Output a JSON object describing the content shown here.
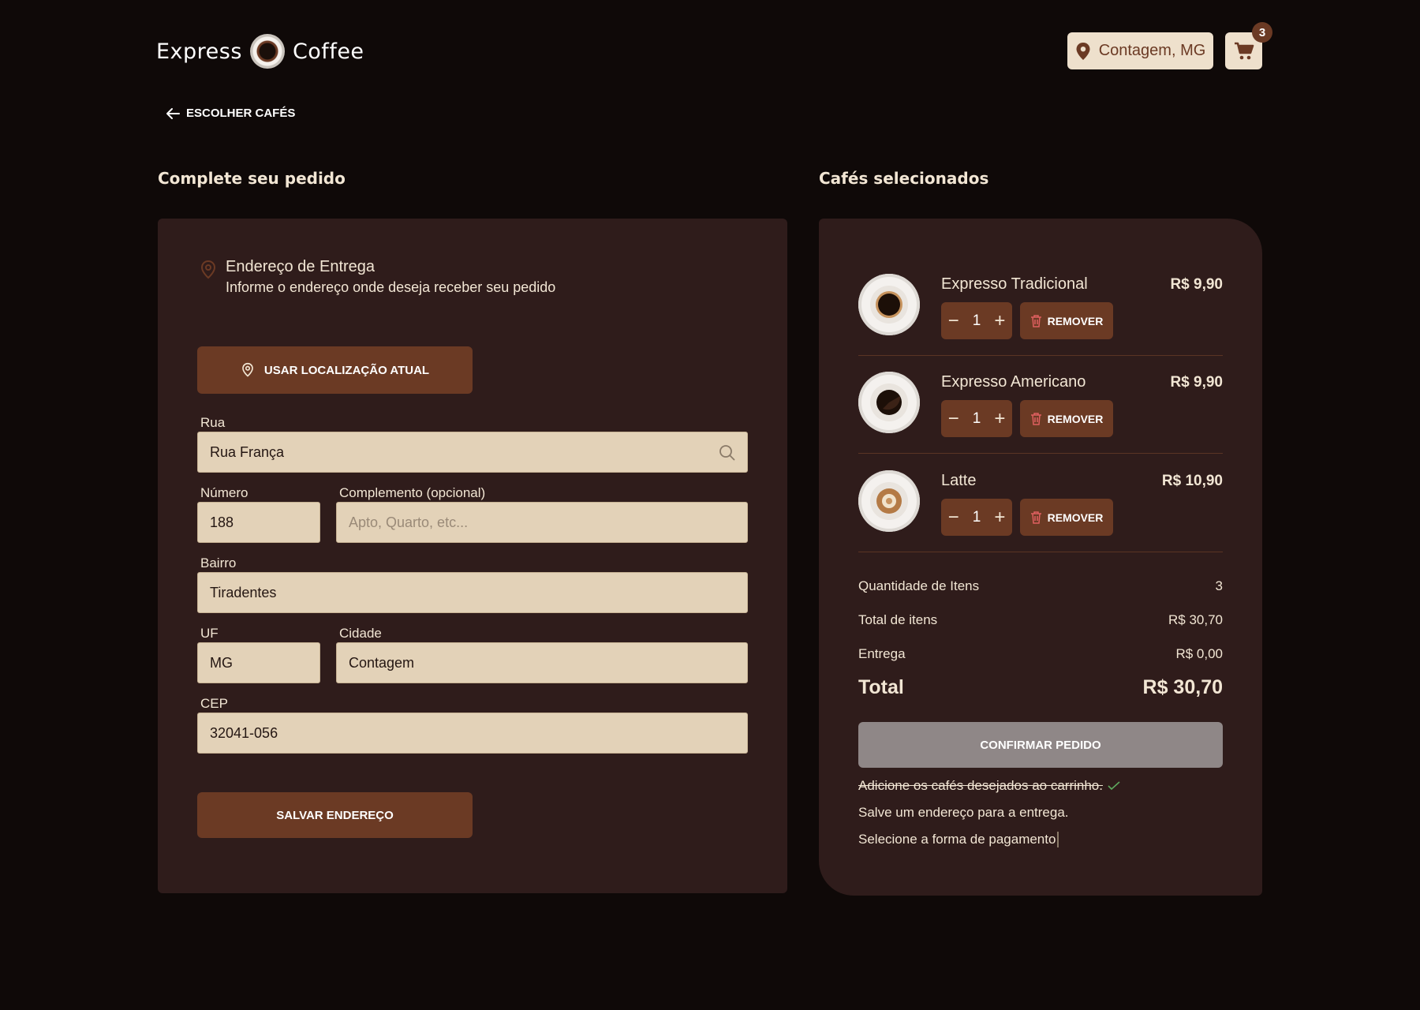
{
  "header": {
    "logo_left": "Express",
    "logo_right": "Coffee",
    "location": "Contagem, MG",
    "cart_count": "3"
  },
  "nav": {
    "back_label": "ESCOLHER CAFÉS"
  },
  "form": {
    "section_title": "Complete seu pedido",
    "address_title": "Endereço de Entrega",
    "address_subtitle": "Informe o endereço onde deseja receber seu pedido",
    "use_location_label": "USAR LOCALIZAÇÃO ATUAL",
    "street_label": "Rua",
    "street_value": "Rua França",
    "number_label": "Número",
    "number_value": "188",
    "complement_label": "Complemento (opcional)",
    "complement_placeholder": "Apto, Quarto, etc...",
    "district_label": "Bairro",
    "district_value": "Tiradentes",
    "uf_label": "UF",
    "uf_value": "MG",
    "city_label": "Cidade",
    "city_value": "Contagem",
    "cep_label": "CEP",
    "cep_value": "32041-056",
    "save_label": "SALVAR ENDEREÇO"
  },
  "cart": {
    "section_title": "Cafés selecionados",
    "remove_label": "REMOVER",
    "items": [
      {
        "name": "Expresso Tradicional",
        "price": "R$ 9,90",
        "qty": "1"
      },
      {
        "name": "Expresso Americano",
        "price": "R$ 9,90",
        "qty": "1"
      },
      {
        "name": "Latte",
        "price": "R$ 10,90",
        "qty": "1"
      }
    ],
    "summary": {
      "qty_label": "Quantidade de Itens",
      "qty_value": "3",
      "items_label": "Total de itens",
      "items_value": "R$ 30,70",
      "delivery_label": "Entrega",
      "delivery_value": "R$ 0,00",
      "total_label": "Total",
      "total_value": "R$ 30,70"
    },
    "confirm_label": "CONFIRMAR PEDIDO",
    "checklist": [
      "Adicione os cafés desejados ao carrinho.",
      "Salve um endereço para a entrega.",
      "Selecione a forma de pagamento"
    ]
  },
  "colors": {
    "accent": "#6b3a24",
    "background": "#0f0908",
    "card": "#2f1c1b",
    "field": "#e3d2b8"
  }
}
